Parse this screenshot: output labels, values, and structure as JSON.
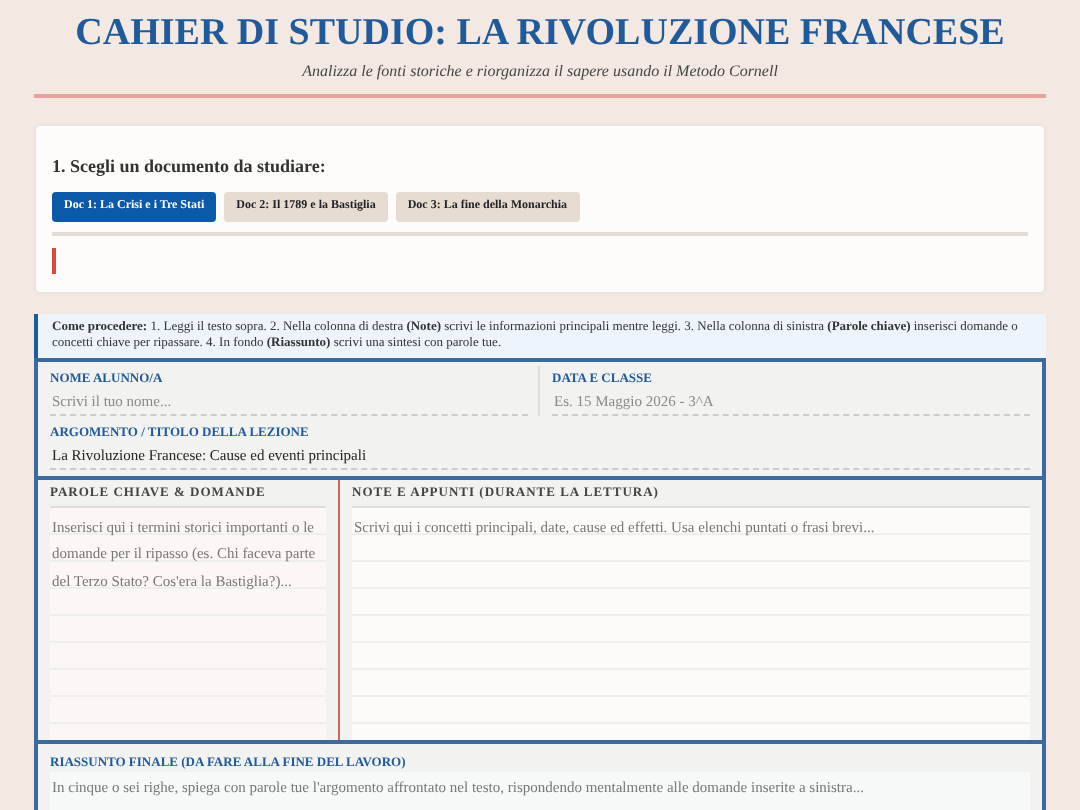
{
  "header": {
    "title": "CAHIER DI STUDIO: LA RIVOLUZIONE FRANCESE",
    "subtitle": "Analizza le fonti storiche e riorganizza il sapere usando il Metodo Cornell"
  },
  "documents": {
    "label": "1. Scegli un documento da studiare:",
    "tabs": [
      {
        "label": "Doc 1: La Crisi e i Tre Stati",
        "selected": true
      },
      {
        "label": "Doc 2: Il 1789 e la Bastiglia",
        "selected": false
      },
      {
        "label": "Doc 3: La fine della Monarchia",
        "selected": false
      }
    ]
  },
  "instructions": "**Come procedere:** 1. Leggi il testo sopra. 2. Nella colonna di destra **(Note)** scrivi le informazioni principali mentre leggi. 3. Nella colonna di sinistra **(Parole chiave)** inserisci domande o concetti chiave per ripassare. 4. In fondo **(Riassunto)** scrivi una sintesi con parole tue.",
  "form": {
    "name": {
      "label": "NOME ALUNNO/A",
      "placeholder": "Scrivi il tuo nome..."
    },
    "date": {
      "label": "DATA E CLASSE",
      "placeholder": "Es. 15 Maggio 2026 - 3^A"
    },
    "topic": {
      "label": "ARGOMENTO / TITOLO DELLA LEZIONE",
      "value": "La Rivoluzione Francese: Cause ed eventi principali"
    }
  },
  "cues": {
    "heading": "PAROLE CHIAVE & DOMANDE",
    "placeholder": "Inserisci qui i termini storici importanti o le domande per il ripasso (es. Chi faceva parte del Terzo Stato? Cos'era la Bastiglia?)..."
  },
  "notes": {
    "heading": "NOTE E APPUNTI (DURANTE LA LETTURA)",
    "placeholder": "Scrivi qui i concetti principali, date, cause ed effetti. Usa elenchi puntati o frasi brevi..."
  },
  "summary": {
    "heading": "RIASSUNTO FINALE (DA FARE ALLA FINE DEL LAVORO)",
    "placeholder": "In cinque o sei righe, spiega con parole tue l'argomento affrontato nel testo, rispondendo mentalmente alle domande inserite a sinistra..."
  }
}
